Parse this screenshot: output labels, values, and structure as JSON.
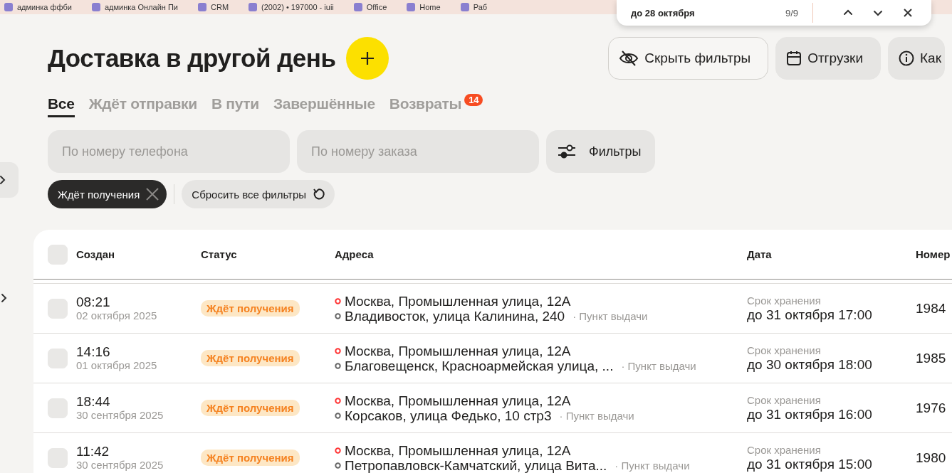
{
  "bookmarks": [
    {
      "label": "админка ффби"
    },
    {
      "label": "админка Онлайн Пи"
    },
    {
      "label": "CRM"
    },
    {
      "label": "(2002) • 197000 - iuii"
    },
    {
      "label": "Office"
    },
    {
      "label": "Home"
    },
    {
      "label": "Раб"
    }
  ],
  "find_bar": {
    "query": "до 28 октября",
    "count": "9/9"
  },
  "page": {
    "title": "Доставка в другой день",
    "header_buttons": [
      "Скрыть фильтры",
      "Отгрузки",
      "Как"
    ],
    "tabs": [
      {
        "label": "Все",
        "selected": true
      },
      {
        "label": "Ждёт отправки",
        "selected": false
      },
      {
        "label": "В пути",
        "selected": false
      },
      {
        "label": "Завершённые",
        "selected": false
      },
      {
        "label": "Возвраты",
        "selected": false,
        "badge": "14"
      }
    ],
    "phone_search": {
      "placeholder": "По номеру телефона"
    },
    "order_search": {
      "placeholder": "По номеру заказа"
    },
    "filters_button": "Фильтры",
    "active_filters": [
      {
        "label": "Ждёт получения"
      }
    ],
    "reset_button": "Сбросить все фильтры"
  },
  "table": {
    "select_all_checked": false,
    "columns": [
      "Создан",
      "Статус",
      "Адреса",
      "Дата",
      "Номер"
    ],
    "rows": [
      {
        "checked": false,
        "time": "08:21",
        "date": "02 октября 2025",
        "status": "Ждёт получения",
        "from": "Москва, Промышленная улица, 12А",
        "to": "Владивосток, улица Калинина, 240",
        "point": "· Пункт выдачи",
        "storage_label": "Срок хранения",
        "storage_until": "до 31 октября 17:00",
        "number": "1984"
      },
      {
        "checked": false,
        "time": "14:16",
        "date": "01 октября 2025",
        "status": "Ждёт получения",
        "from": "Москва, Промышленная улица, 12А",
        "to": "Благовещенск, Красноармейская улица, ...",
        "point": "· Пункт выдачи",
        "storage_label": "Срок хранения",
        "storage_until": "до 30 октября 18:00",
        "number": "1985"
      },
      {
        "checked": false,
        "time": "18:44",
        "date": "30 сентября 2025",
        "status": "Ждёт получения",
        "from": "Москва, Промышленная улица, 12А",
        "to": "Корсаков, улица Федько, 10 стр3",
        "point": "· Пункт выдачи",
        "storage_label": "Срок хранения",
        "storage_until": "до 31 октября 16:00",
        "number": "1976"
      },
      {
        "checked": false,
        "time": "11:42",
        "date": "30 сентября 2025",
        "status": "Ждёт получения",
        "from": "Москва, Промышленная улица, 12А",
        "to": "Петропавловск-Камчатский, улица Вита...",
        "point": "· Пункт выдачи",
        "storage_label": "Срок хранения",
        "storage_until": "до 31 октября 15:00",
        "number": "1980"
      }
    ]
  }
}
